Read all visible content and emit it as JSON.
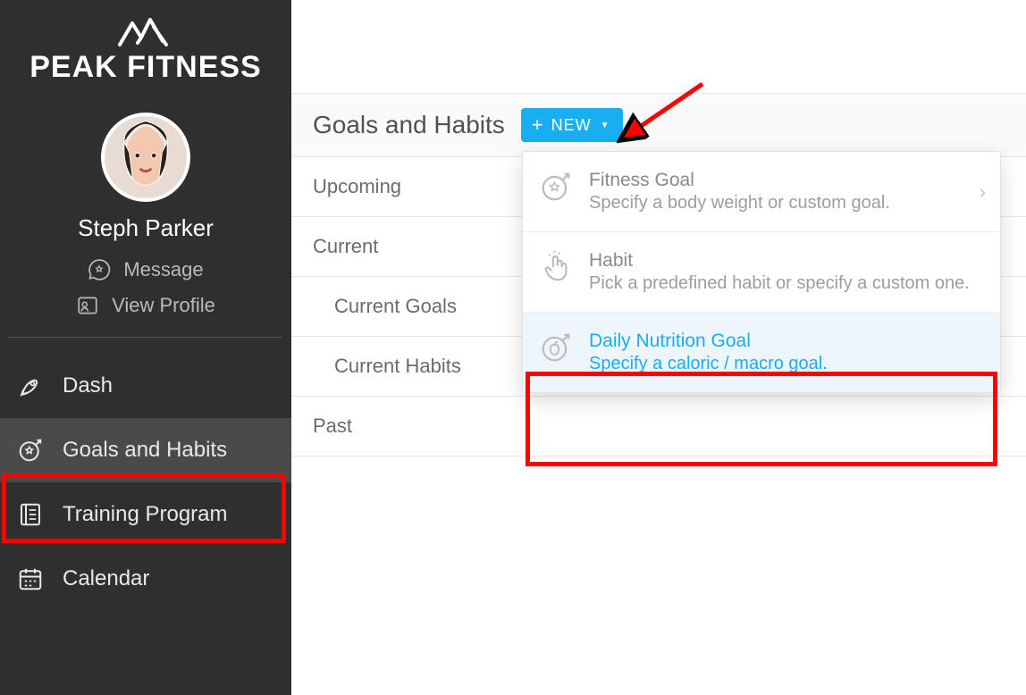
{
  "brand": {
    "name": "PEAK FITNESS"
  },
  "user": {
    "name": "Steph Parker",
    "actions": {
      "message": "Message",
      "view_profile": "View Profile"
    }
  },
  "nav": {
    "dash": "Dash",
    "goals": "Goals and Habits",
    "training": "Training Program",
    "calendar": "Calendar"
  },
  "panel": {
    "title": "Goals and Habits",
    "new_label": "NEW",
    "sections": {
      "upcoming": "Upcoming",
      "current": "Current",
      "current_goals": "Current Goals",
      "current_habits": "Current Habits",
      "past": "Past"
    }
  },
  "new_menu": [
    {
      "title": "Fitness Goal",
      "desc": "Specify a body weight or custom goal."
    },
    {
      "title": "Habit",
      "desc": "Pick a predefined habit or specify a custom one."
    },
    {
      "title": "Daily Nutrition Goal",
      "desc": "Specify a caloric / macro goal."
    }
  ]
}
